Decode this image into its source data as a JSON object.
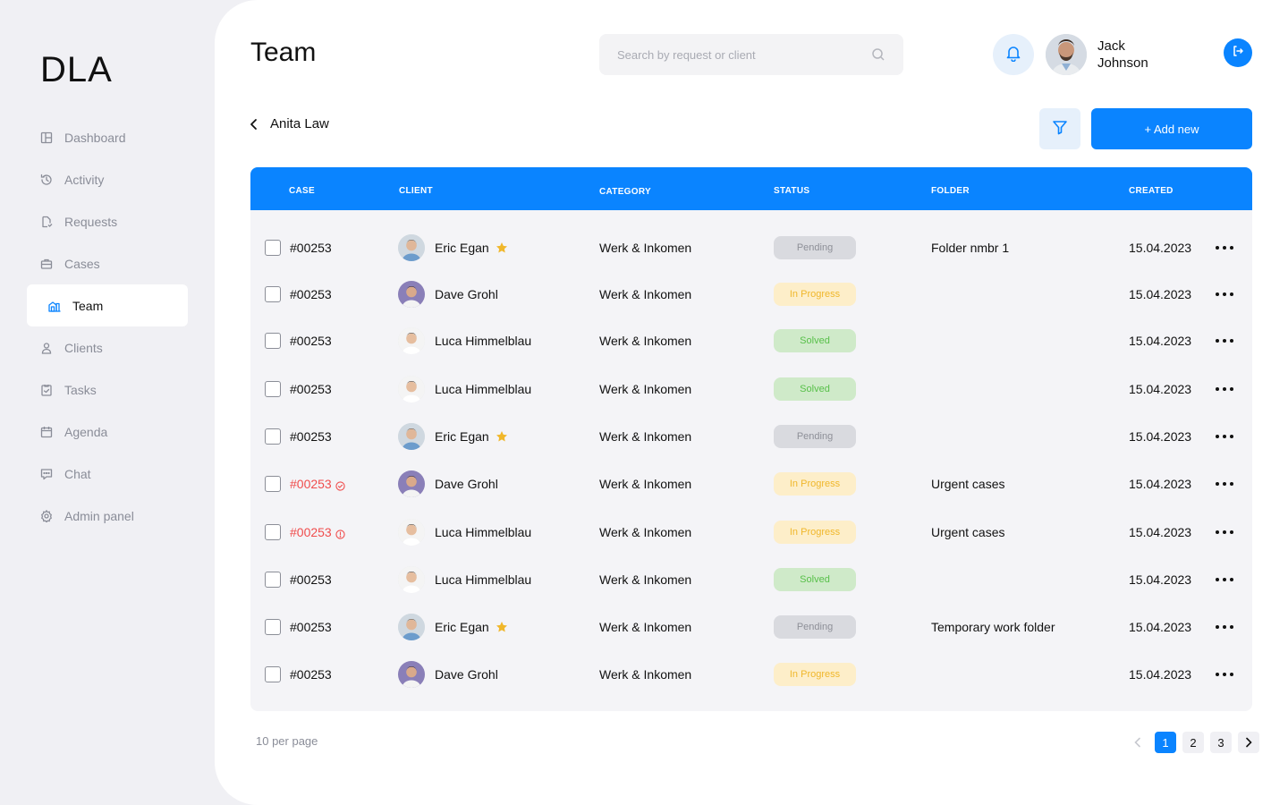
{
  "brand": {
    "logo": "DLA"
  },
  "sidebar": {
    "items": [
      {
        "label": "Dashboard",
        "icon": "dashboard-icon",
        "active": false
      },
      {
        "label": "Activity",
        "icon": "history-icon",
        "active": false
      },
      {
        "label": "Requests",
        "icon": "request-icon",
        "active": false
      },
      {
        "label": "Cases",
        "icon": "briefcase-icon",
        "active": false
      },
      {
        "label": "Team",
        "icon": "team-icon",
        "active": true
      },
      {
        "label": "Clients",
        "icon": "user-icon",
        "active": false
      },
      {
        "label": "Tasks",
        "icon": "task-icon",
        "active": false
      },
      {
        "label": "Agenda",
        "icon": "calendar-icon",
        "active": false
      },
      {
        "label": "Chat",
        "icon": "chat-icon",
        "active": false
      },
      {
        "label": "Admin panel",
        "icon": "settings-icon",
        "active": false
      }
    ]
  },
  "header": {
    "title": "Team",
    "search_placeholder": "Search by request or client",
    "user": {
      "first": "Jack",
      "last": "Johnson"
    }
  },
  "toolbar": {
    "back_label": "Anita Law",
    "add_label": "+ Add new"
  },
  "table": {
    "columns": [
      "CASE",
      "CLIENT",
      "CATEGORY",
      "STATUS",
      "FOLDER",
      "CREATED"
    ],
    "rows": [
      {
        "case": "#00253",
        "urgent": false,
        "client": "Eric Egan",
        "star": true,
        "category": "Werk & Inkomen",
        "status": "Pending",
        "folder": "Folder nmbr 1",
        "created": "15.04.2023"
      },
      {
        "case": "#00253",
        "urgent": false,
        "client": "Dave Grohl",
        "star": false,
        "category": "Werk & Inkomen",
        "status": "In Progress",
        "folder": "",
        "created": "15.04.2023"
      },
      {
        "case": "#00253",
        "urgent": false,
        "client": "Luca Himmelblau",
        "star": false,
        "category": "Werk & Inkomen",
        "status": "Solved",
        "folder": "",
        "created": "15.04.2023"
      },
      {
        "case": "#00253",
        "urgent": false,
        "client": "Luca Himmelblau",
        "star": false,
        "category": "Werk & Inkomen",
        "status": "Solved",
        "folder": "",
        "created": "15.04.2023"
      },
      {
        "case": "#00253",
        "urgent": false,
        "client": "Eric Egan",
        "star": true,
        "category": "Werk & Inkomen",
        "status": "Pending",
        "folder": "",
        "created": "15.04.2023"
      },
      {
        "case": "#00253",
        "urgent": true,
        "mark": "check",
        "client": "Dave Grohl",
        "star": false,
        "category": "Werk & Inkomen",
        "status": "In Progress",
        "folder": "Urgent cases",
        "created": "15.04.2023"
      },
      {
        "case": "#00253",
        "urgent": true,
        "mark": "alert",
        "client": "Luca Himmelblau",
        "star": false,
        "category": "Werk & Inkomen",
        "status": "In Progress",
        "folder": "Urgent cases",
        "created": "15.04.2023"
      },
      {
        "case": "#00253",
        "urgent": false,
        "client": "Luca Himmelblau",
        "star": false,
        "category": "Werk & Inkomen",
        "status": "Solved",
        "folder": "",
        "created": "15.04.2023"
      },
      {
        "case": "#00253",
        "urgent": false,
        "client": "Eric Egan",
        "star": true,
        "category": "Werk & Inkomen",
        "status": "Pending",
        "folder": "Temporary work folder",
        "created": "15.04.2023"
      },
      {
        "case": "#00253",
        "urgent": false,
        "client": "Dave Grohl",
        "star": false,
        "category": "Werk & Inkomen",
        "status": "In Progress",
        "folder": "",
        "created": "15.04.2023"
      }
    ]
  },
  "footer": {
    "per_page": "10 per page",
    "pages": [
      "1",
      "2",
      "3"
    ],
    "current_page": "1"
  },
  "colors": {
    "accent": "#0a84ff",
    "urgent": "#f04d4d",
    "star": "#f0b72b"
  }
}
